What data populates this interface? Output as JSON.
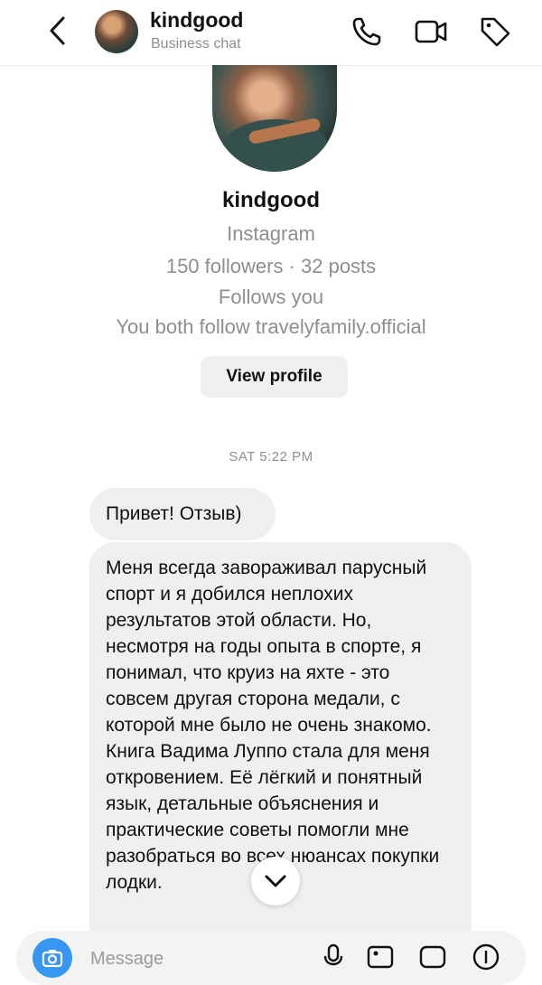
{
  "header": {
    "name": "kindgood",
    "subtitle": "Business chat",
    "icons": [
      "back-icon",
      "phone-icon",
      "video-camera-icon",
      "tag-icon"
    ]
  },
  "profile": {
    "name": "kindgood",
    "platform": "Instagram",
    "stats": "150 followers · 32 posts",
    "follows": "Follows you",
    "mutual": "You both follow travelyfamily.official",
    "view_profile_label": "View profile"
  },
  "timestamp": "SAT 5:22 PM",
  "messages": [
    {
      "text": "Привет! Отзыв)"
    },
    {
      "text": "Меня всегда завораживал парусный спорт и я добился неплохих результатов этой области. Но, несмотря на годы опыта в спорте, я понимал, что круиз на яхте - это совсем другая сторона медали, с которой мне было не очень знакомо.\n Книга Вадима Луппо стала для меня откровением. Её лёгкий и понятный язык, детальные объяснения и практические советы помогли мне разобраться во всех нюансах покупки лодки."
    }
  ],
  "composer": {
    "placeholder": "Message"
  },
  "colors": {
    "accent": "#3797f0",
    "bubble": "#efefef",
    "secondary_text": "#8e8e8e"
  }
}
